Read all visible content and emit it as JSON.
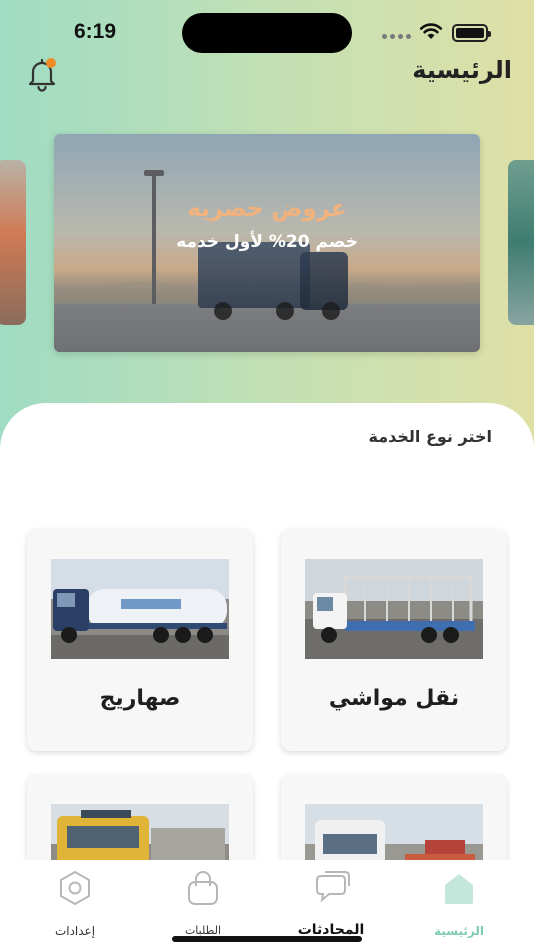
{
  "status_bar": {
    "time": "6:19"
  },
  "header": {
    "title": "الرئيسية",
    "notification_icon": "bell-icon",
    "notification_dot_color": "#f28c28"
  },
  "banner": {
    "headline": "عروض حصريه",
    "subtext": "خصم 20% لأول خدمه"
  },
  "services": {
    "title": "اختر نوع الخدمة",
    "items": [
      {
        "label": "نقل مواشي"
      },
      {
        "label": "صهاريج"
      },
      {
        "label": ""
      },
      {
        "label": ""
      }
    ]
  },
  "bottom_nav": {
    "active_color": "#7fcdb0",
    "items": [
      {
        "label": "الرئيسية",
        "icon": "home-icon",
        "active": true
      },
      {
        "label": "المحادثات",
        "icon": "chat-icon",
        "active": false
      },
      {
        "label": "الطلبات",
        "icon": "bag-icon",
        "active": false
      },
      {
        "label": "إعدادات",
        "icon": "settings-icon",
        "active": false
      }
    ]
  }
}
